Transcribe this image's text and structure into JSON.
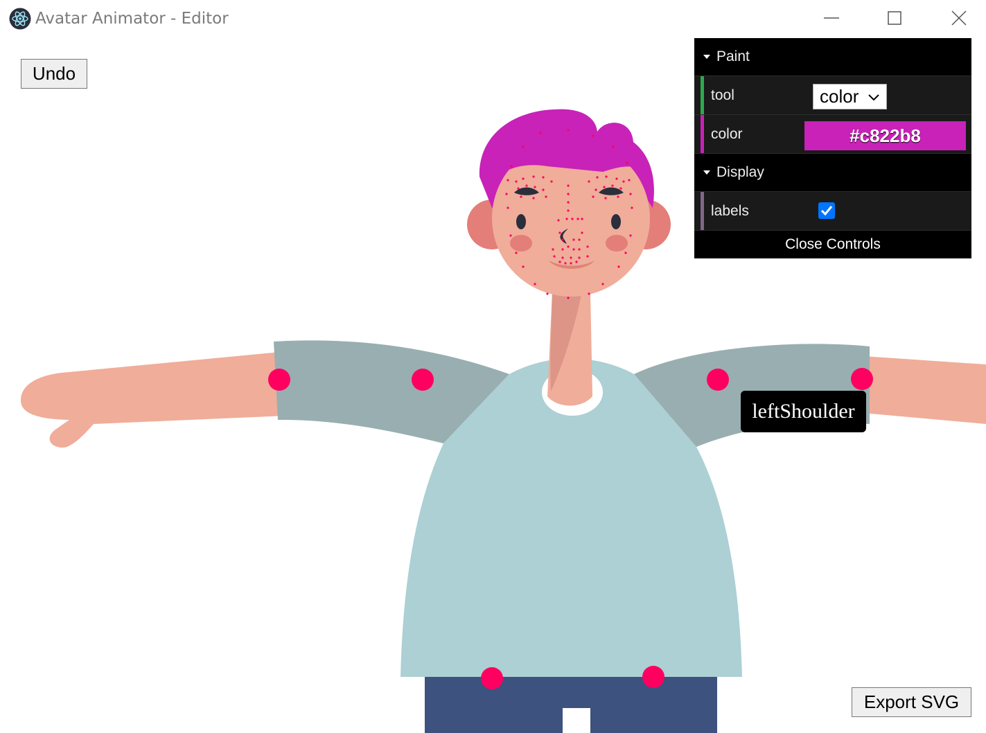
{
  "window": {
    "title": "Avatar Animator - Editor",
    "icon": "electron-atom-icon"
  },
  "toolbar": {
    "undo_label": "Undo",
    "export_label": "Export SVG"
  },
  "tooltip": {
    "text": "leftShoulder"
  },
  "controls": {
    "paint": {
      "title": "Paint",
      "tool_label": "tool",
      "tool_value": "color",
      "color_label": "color",
      "color_value": "#c822b8"
    },
    "display": {
      "title": "Display",
      "labels_label": "labels",
      "labels_checked": true
    },
    "close_label": "Close Controls"
  },
  "colors": {
    "skin": "#f0ad9a",
    "hair": "#c822b8",
    "sleeve": "#99aeb0",
    "shirt": "#acd0d4",
    "pants": "#3d527e",
    "joint": "#ff0060",
    "accent_tool": "#2fa84f",
    "accent_color": "#c822b8",
    "accent_display": "#806787"
  }
}
